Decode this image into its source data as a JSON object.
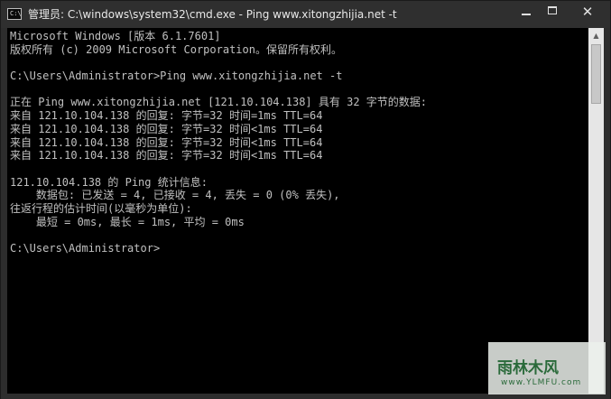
{
  "window": {
    "title": "管理员: C:\\windows\\system32\\cmd.exe - Ping  www.xitongzhijia.net -t",
    "app_icon_text": "C:\\",
    "minimize_label": "",
    "maximize_label": "",
    "close_label": "✕"
  },
  "console": {
    "lines": [
      "Microsoft Windows [版本 6.1.7601]",
      "版权所有 (c) 2009 Microsoft Corporation。保留所有权利。",
      "",
      "C:\\Users\\Administrator>Ping www.xitongzhijia.net -t",
      "",
      "正在 Ping www.xitongzhijia.net [121.10.104.138] 具有 32 字节的数据:",
      "来自 121.10.104.138 的回复: 字节=32 时间=1ms TTL=64",
      "来自 121.10.104.138 的回复: 字节=32 时间<1ms TTL=64",
      "来自 121.10.104.138 的回复: 字节=32 时间<1ms TTL=64",
      "来自 121.10.104.138 的回复: 字节=32 时间<1ms TTL=64",
      "",
      "121.10.104.138 的 Ping 统计信息:",
      "    数据包: 已发送 = 4, 已接收 = 4, 丢失 = 0 (0% 丢失),",
      "往返行程的估计时间(以毫秒为单位):",
      "    最短 = 0ms, 最长 = 1ms, 平均 = 0ms",
      "",
      "C:\\Users\\Administrator>"
    ]
  },
  "scrollbar": {
    "up_arrow": "▲"
  },
  "watermark": {
    "text": "雨林木风",
    "url": "www.YLMFU.com"
  }
}
